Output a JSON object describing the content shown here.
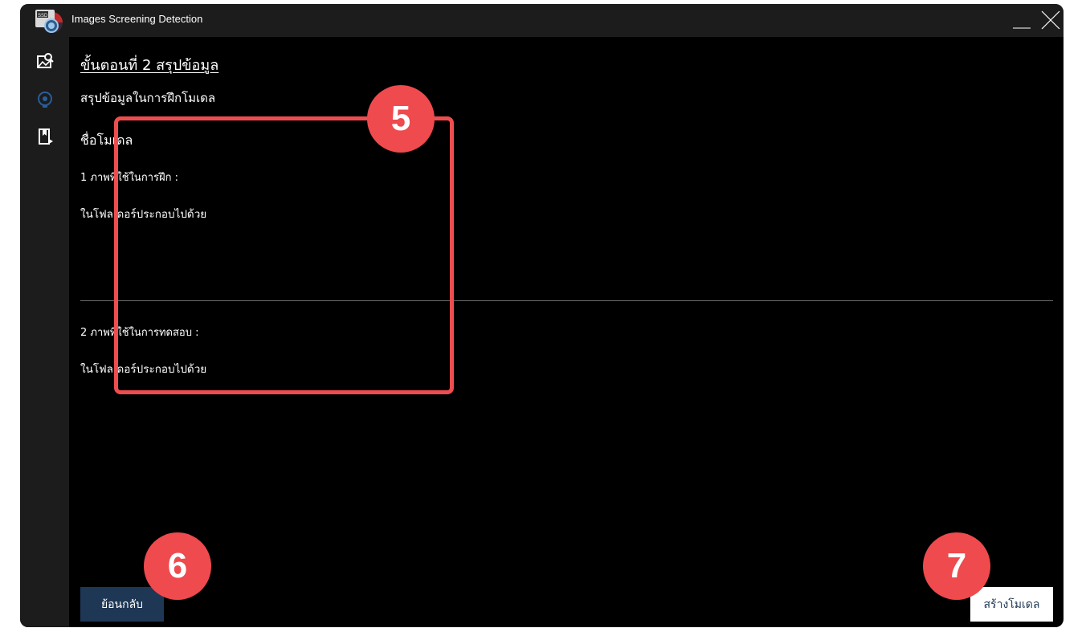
{
  "window": {
    "title": "Images Screening Detection",
    "logo_text": "SSD"
  },
  "titlebar_icons": [
    "minimize-icon",
    "close-icon"
  ],
  "sidebar": {
    "items": [
      {
        "icon": "image-search-icon"
      },
      {
        "icon": "brain-icon"
      },
      {
        "icon": "bookmark-play-icon"
      }
    ]
  },
  "main": {
    "step_title": "ขั้นตอนที่ 2 สรุปข้อมูล",
    "summary_heading": "สรุปข้อมูลในการฝึกโมเดล",
    "model_name_label": "ชื่อโมเดล",
    "train_images_label": "1  ภาพที่ใช้ในการฝึก  :",
    "train_folder_label": "ในโฟลเดอร์ประกอบไปด้วย",
    "test_images_label": "2  ภาพที่ใช้ในการทดสอบ  :",
    "test_folder_label": "ในโฟลเดอร์ประกอบไปด้วย"
  },
  "buttons": {
    "back": "ย้อนกลับ",
    "create_model": "สร้างโมเดล"
  },
  "annotations": {
    "badge_5": "5",
    "badge_6": "6",
    "badge_7": "7"
  },
  "colors": {
    "accent": "#1e3755",
    "annotation_red": "#ef4a4d",
    "background": "#000000",
    "chrome": "#1c1c1c"
  }
}
